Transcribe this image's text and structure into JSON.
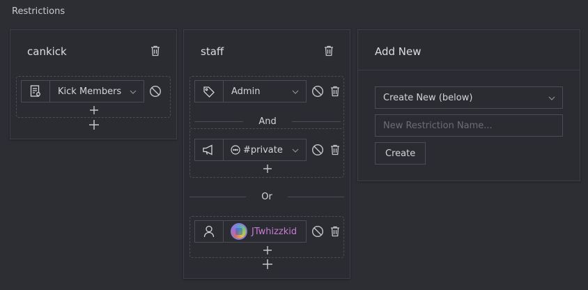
{
  "section": {
    "title": "Restrictions"
  },
  "cards": [
    {
      "title": "cankick",
      "groups": [
        {
          "rows": [
            {
              "icon": "permission-icon",
              "type": "select",
              "value": "Kick Members"
            }
          ]
        }
      ]
    },
    {
      "title": "staff",
      "groups": [
        {
          "rows": [
            {
              "icon": "tag-icon",
              "type": "select",
              "value": "Admin"
            }
          ]
        },
        {
          "operator": "And"
        },
        {
          "rows": [
            {
              "icon": "megaphone-icon",
              "type": "select",
              "value": "#private",
              "prefix_icon": "channel-icon"
            }
          ]
        },
        {
          "operator": "Or"
        },
        {
          "rows": [
            {
              "icon": "user-icon",
              "type": "user",
              "value": "JTwhizzkid"
            }
          ]
        }
      ]
    }
  ],
  "add_new": {
    "title": "Add New",
    "select_value": "Create New (below)",
    "name_placeholder": "New Restriction Name...",
    "create_label": "Create"
  },
  "colors": {
    "background": "#2c2e34",
    "card": "#2a2c31",
    "border": "#4a4d54",
    "username": "#c77bd4"
  }
}
